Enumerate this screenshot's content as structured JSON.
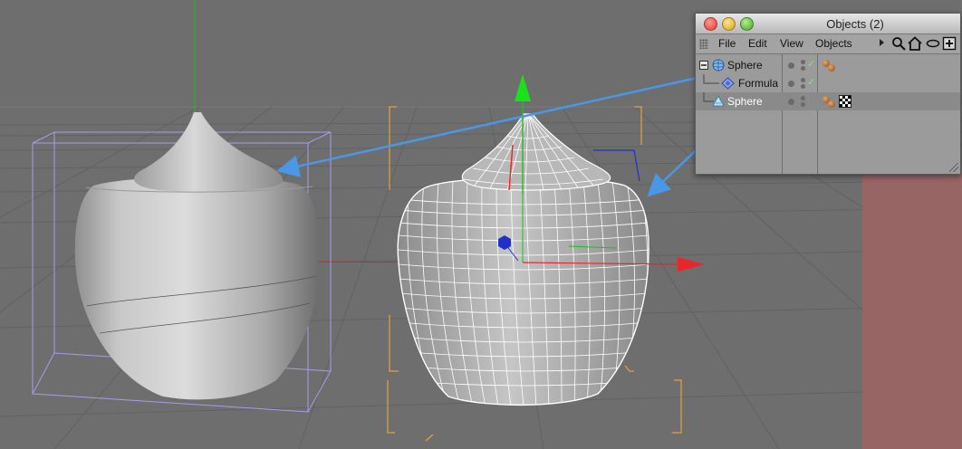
{
  "viewport": {
    "scene": "3d-perspective",
    "objects": [
      "shaded-vase",
      "wireframe-vase"
    ],
    "colors": {
      "background": "#6e6e6e",
      "grid": "#5f5f5f",
      "bounding_box": "#a99be8",
      "selection_brackets": "#e3a33a",
      "axis_x": "#e8262b",
      "axis_y": "#19c219",
      "axis_z": "#2030c8",
      "annotation_arrow": "#4a97e6",
      "red_overlay": "#a06464"
    }
  },
  "objects_panel": {
    "title": "Objects (2)",
    "menu": [
      "File",
      "Edit",
      "View",
      "Objects"
    ],
    "toolbar_icons": [
      "play-icon",
      "search-icon",
      "home-icon",
      "eye-icon",
      "add-icon"
    ],
    "items": [
      {
        "label": "Sphere",
        "icon": "sphere-icon",
        "expander": "minus",
        "tags": [
          "material-tag"
        ],
        "check": true
      },
      {
        "label": "Formula",
        "icon": "formula-icon",
        "tags": [],
        "check": true
      },
      {
        "label": "Sphere",
        "icon": "sphere-triangle-icon",
        "tags": [
          "material-tag",
          "texture-tag"
        ],
        "check": false,
        "selected": true
      }
    ]
  }
}
